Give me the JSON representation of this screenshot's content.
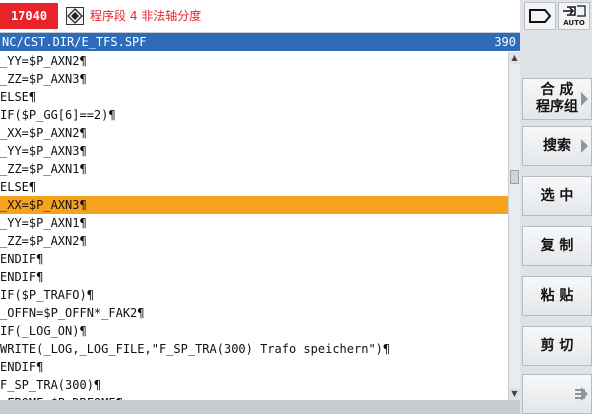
{
  "alarm": {
    "number": "17040",
    "message": "程序段 4 非法轴分度"
  },
  "top_buttons": {
    "auto_label": "AUTO"
  },
  "file": {
    "path": "NC/CST.DIR/E_TFS.SPF",
    "line_number": "390"
  },
  "code_lines": [
    {
      "text": "_YY=$P_AXN2¶",
      "selected": false
    },
    {
      "text": "_ZZ=$P_AXN3¶",
      "selected": false
    },
    {
      "text": "ELSE¶",
      "selected": false
    },
    {
      "text": "IF($P_GG[6]==2)¶",
      "selected": false
    },
    {
      "text": "_XX=$P_AXN2¶",
      "selected": false
    },
    {
      "text": "_YY=$P_AXN3¶",
      "selected": false
    },
    {
      "text": "_ZZ=$P_AXN1¶",
      "selected": false
    },
    {
      "text": "ELSE¶",
      "selected": false
    },
    {
      "text": "_XX=$P_AXN3¶",
      "selected": true
    },
    {
      "text": "_YY=$P_AXN1¶",
      "selected": false
    },
    {
      "text": "_ZZ=$P_AXN2¶",
      "selected": false
    },
    {
      "text": "ENDIF¶",
      "selected": false
    },
    {
      "text": "ENDIF¶",
      "selected": false
    },
    {
      "text": "IF($P_TRAFO)¶",
      "selected": false
    },
    {
      "text": "_OFFN=$P_OFFN*_FAK2¶",
      "selected": false
    },
    {
      "text": "IF(_LOG_ON)¶",
      "selected": false
    },
    {
      "text": "WRITE(_LOG,_LOG_FILE,\"F_SP_TRA(300) Trafo speichern\")¶",
      "selected": false
    },
    {
      "text": "ENDIF¶",
      "selected": false
    },
    {
      "text": "F_SP_TRA(300)¶",
      "selected": false
    },
    {
      "text": "_FROME=$P_DRFOME¶",
      "selected": false
    }
  ],
  "softkeys": {
    "compose_line1": "合 成",
    "compose_line2": "程序组",
    "search": "搜索",
    "select": "选 中",
    "copy": "复 制",
    "paste": "粘 贴",
    "cut": "剪 切"
  },
  "colors": {
    "alarm_red": "#e8232a",
    "header_blue": "#2e6bb8",
    "selection_orange": "#f7a21e"
  }
}
